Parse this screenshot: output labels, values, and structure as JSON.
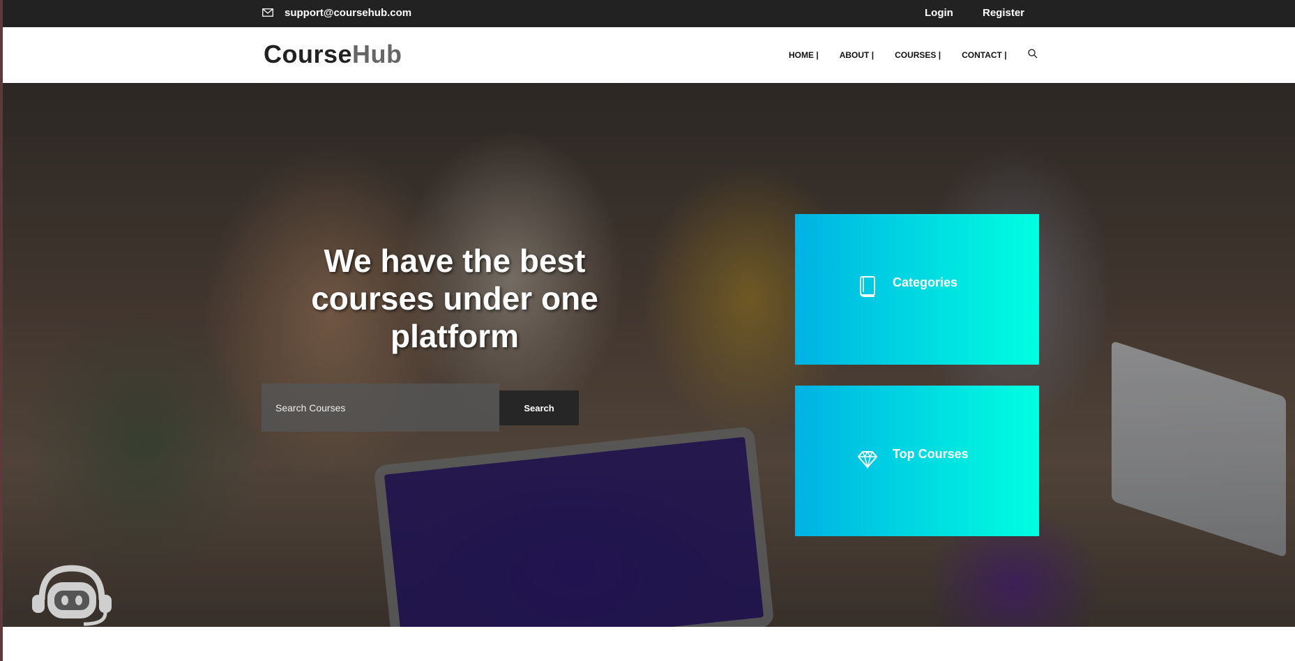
{
  "topbar": {
    "email": "support@coursehub.com",
    "login_label": "Login",
    "register_label": "Register",
    "mail_icon": "mail-icon"
  },
  "header": {
    "logo_part1": "Course",
    "logo_part2": "Hub",
    "nav": [
      {
        "label": "HOME |"
      },
      {
        "label": "ABOUT |"
      },
      {
        "label": "COURSES |"
      },
      {
        "label": "CONTACT |"
      }
    ],
    "search_icon": "search-icon"
  },
  "hero": {
    "title": "We have the best courses under one platform",
    "search_placeholder": "Search Courses",
    "search_button": "Search",
    "cards": [
      {
        "label": "Categories",
        "icon": "book-icon"
      },
      {
        "label": "Top Courses",
        "icon": "diamond-icon"
      }
    ],
    "chatbot_icon": "chatbot-icon"
  },
  "colors": {
    "topbar_bg": "#222222",
    "card_gradient_start": "#00b2e3",
    "card_gradient_end": "#00ffe0",
    "search_button_bg": "#262626"
  }
}
